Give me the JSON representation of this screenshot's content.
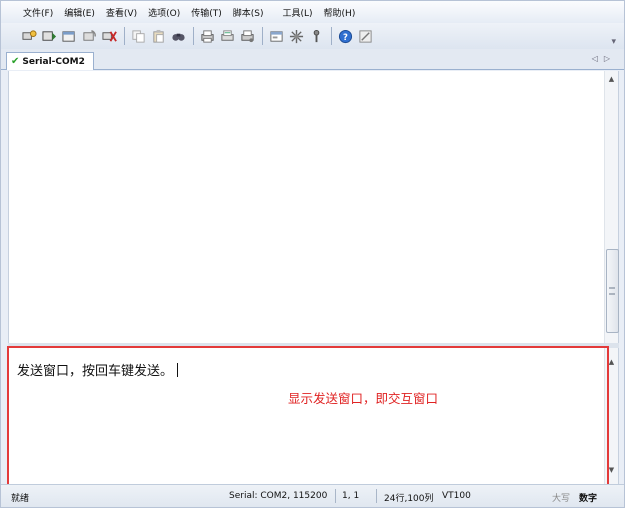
{
  "menu": [
    "文件(F)",
    "编辑(E)",
    "查看(V)",
    "选项(O)",
    "传输(T)",
    "脚本(S)",
    "工具(L)",
    "帮助(H)"
  ],
  "tab": {
    "label": "Serial-COM2"
  },
  "send_window": {
    "text": "发送窗口，按回车键发送。"
  },
  "annotation": "显示发送窗口，即交互窗口",
  "status": {
    "state": "就绪",
    "connection": "Serial: COM2, 115200",
    "cursor": "1,  1",
    "size": "24行,100列",
    "emulation": "VT100",
    "caps": "大写",
    "num": "数字"
  },
  "colors": {
    "annotation": "#e02323",
    "highlight_box": "#e33a3a",
    "tab_check": "#2aa12a"
  }
}
